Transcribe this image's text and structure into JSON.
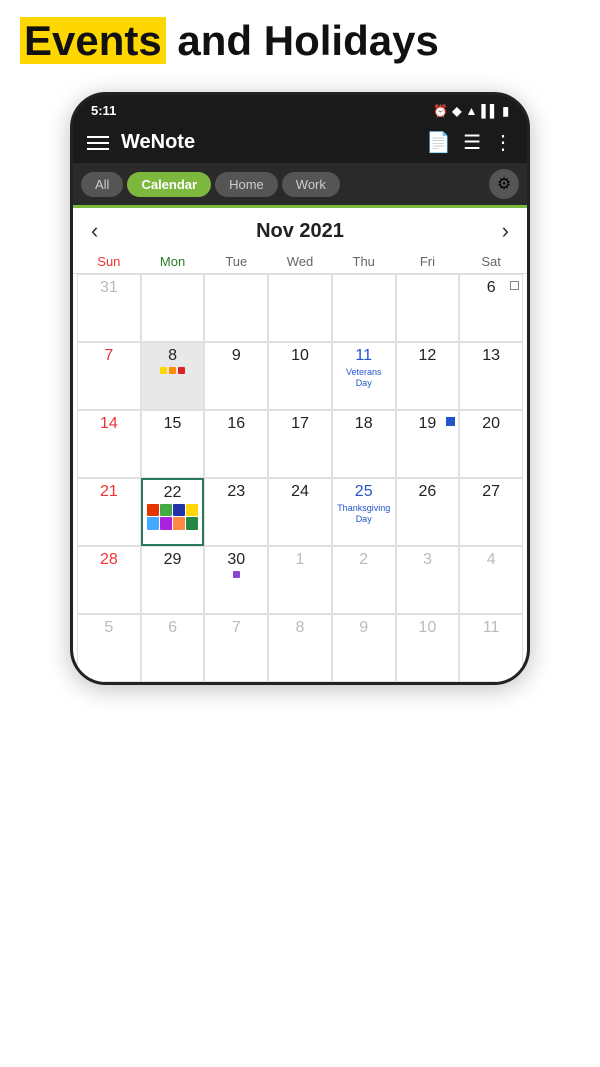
{
  "header": {
    "title_part1": "Events",
    "title_part2": " and Holidays"
  },
  "status_bar": {
    "time": "5:11",
    "icons": "⏰ ◆ ▲ ▌▌ 🔋"
  },
  "toolbar": {
    "app_name": "WeNote"
  },
  "tabs": [
    {
      "label": "All",
      "active": false
    },
    {
      "label": "Calendar",
      "active": true
    },
    {
      "label": "Home",
      "active": false
    },
    {
      "label": "Work",
      "active": false
    }
  ],
  "calendar": {
    "month_year": "Nov 2021",
    "day_headers": [
      "Sun",
      "Mon",
      "Tue",
      "Wed",
      "Thu",
      "Fri",
      "Sat"
    ],
    "weeks": [
      [
        {
          "date": "31",
          "other": true,
          "day": "sun"
        },
        {
          "date": "",
          "other": true
        },
        {
          "date": "",
          "other": true
        },
        {
          "date": "",
          "other": true
        },
        {
          "date": "",
          "other": true
        },
        {
          "date": "",
          "other": true
        },
        {
          "date": "6",
          "day": "sat",
          "has_sq_empty": true
        }
      ],
      [
        {
          "date": "7",
          "day": "sun"
        },
        {
          "date": "8",
          "highlighted": true,
          "dots": [
            "yellow",
            "orange",
            "red"
          ]
        },
        {
          "date": "9"
        },
        {
          "date": "10"
        },
        {
          "date": "11",
          "blue": true,
          "holiday": "Veterans\nDay"
        },
        {
          "date": "12"
        },
        {
          "date": "13"
        }
      ],
      [
        {
          "date": "14",
          "day": "sun"
        },
        {
          "date": "15"
        },
        {
          "date": "16"
        },
        {
          "date": "17"
        },
        {
          "date": "18"
        },
        {
          "date": "19",
          "has_sq_blue": true
        },
        {
          "date": "20"
        }
      ],
      [
        {
          "date": "21",
          "day": "sun"
        },
        {
          "date": "22",
          "today": true,
          "event_squares": [
            "#e63",
            "#4a4",
            "#229",
            "#FF0",
            "#4af",
            "#a2d",
            "#f84",
            "#2a8"
          ]
        },
        {
          "date": "23"
        },
        {
          "date": "24"
        },
        {
          "date": "25",
          "blue": true,
          "holiday": "Thanksgiv\ning Day"
        },
        {
          "date": "26"
        },
        {
          "date": "27"
        }
      ],
      [
        {
          "date": "28",
          "day": "sun"
        },
        {
          "date": "29"
        },
        {
          "date": "30",
          "dots": [
            "purple"
          ]
        },
        {
          "date": "1",
          "other": true
        },
        {
          "date": "2",
          "other": true
        },
        {
          "date": "3",
          "other": true
        },
        {
          "date": "4",
          "other": true
        }
      ],
      [
        {
          "date": "5",
          "other": true,
          "day": "sun"
        },
        {
          "date": "6",
          "other": true
        },
        {
          "date": "7",
          "other": true
        },
        {
          "date": "8",
          "other": true
        },
        {
          "date": "9",
          "other": true
        },
        {
          "date": "10",
          "other": true
        },
        {
          "date": "11",
          "other": true
        }
      ]
    ]
  }
}
